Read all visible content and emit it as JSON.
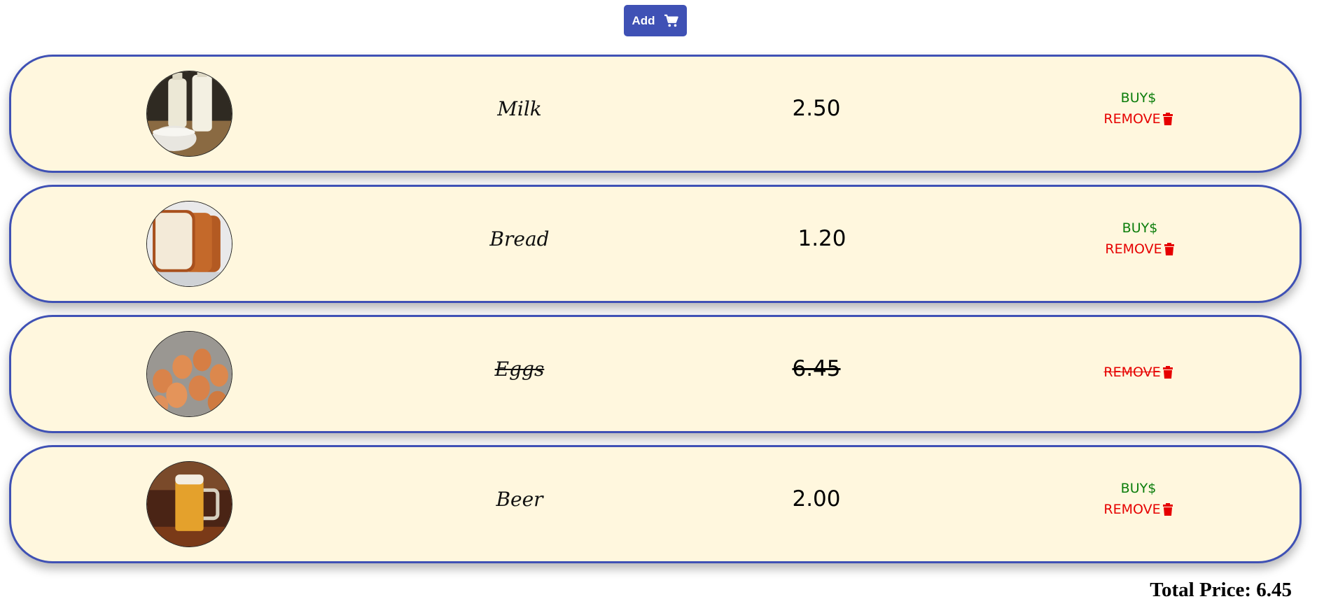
{
  "add_button": {
    "label": "Add",
    "icon": "cart-icon",
    "color": "#3f51b5"
  },
  "items": [
    {
      "name": "Milk",
      "price": "2.50",
      "buy_label": "BUY$",
      "remove_label": "REMOVE",
      "bought": false,
      "image": "milk-image"
    },
    {
      "name": "Bread",
      "price": "1.20",
      "buy_label": "BUY$",
      "remove_label": "REMOVE",
      "bought": false,
      "image": "bread-image"
    },
    {
      "name": "Eggs",
      "price": "6.45",
      "buy_label": "",
      "remove_label": "REMOVE",
      "bought": true,
      "image": "eggs-image"
    },
    {
      "name": "Beer",
      "price": "2.00",
      "buy_label": "BUY$",
      "remove_label": "REMOVE",
      "bought": false,
      "image": "beer-image"
    }
  ],
  "total": {
    "label": "Total Price: 6.45"
  },
  "colors": {
    "card_bg": "#fff7de",
    "border": "#3f51b5",
    "buy": "#0a7d0a",
    "remove": "#e60000"
  }
}
